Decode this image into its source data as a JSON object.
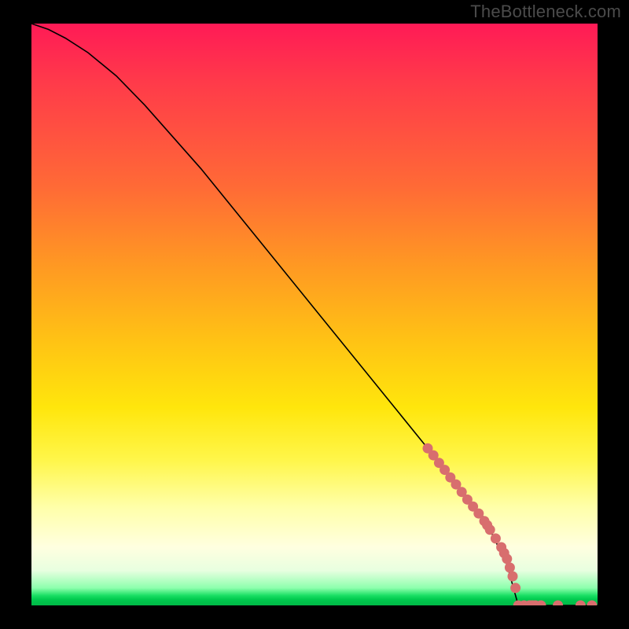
{
  "watermark": "TheBottleneck.com",
  "colors": {
    "dot": "#d86e6e",
    "curve": "#000000",
    "frame": "#000000"
  },
  "chart_data": {
    "type": "line",
    "title": "",
    "xlabel": "",
    "ylabel": "",
    "xlim": [
      0,
      100
    ],
    "ylim": [
      0,
      100
    ],
    "grid": false,
    "legend": false,
    "series": [
      {
        "name": "bottleneck-curve",
        "type": "line",
        "x": [
          0,
          3,
          6,
          10,
          15,
          20,
          30,
          40,
          50,
          60,
          70,
          80,
          84,
          86
        ],
        "y": [
          100,
          99,
          97.5,
          95,
          91,
          86,
          75,
          63,
          51,
          39,
          27,
          15,
          7,
          0
        ]
      },
      {
        "name": "zero-line",
        "type": "line",
        "x": [
          86,
          100
        ],
        "y": [
          0,
          0
        ]
      },
      {
        "name": "overlay-dots",
        "type": "scatter",
        "x": [
          70,
          71,
          72,
          73,
          74,
          75,
          76,
          77,
          78,
          79,
          80,
          80.5,
          81,
          82,
          83,
          83.5,
          84,
          84.5,
          85,
          85.5,
          86,
          87,
          88,
          88.5,
          89,
          90,
          93,
          97,
          99
        ],
        "y": [
          27,
          25.8,
          24.5,
          23.3,
          22,
          20.8,
          19.5,
          18.2,
          17,
          15.8,
          14.5,
          13.8,
          13,
          11.5,
          10,
          9,
          8,
          6.5,
          5,
          3,
          0,
          0,
          0,
          0,
          0,
          0,
          0,
          0,
          0
        ]
      }
    ]
  }
}
